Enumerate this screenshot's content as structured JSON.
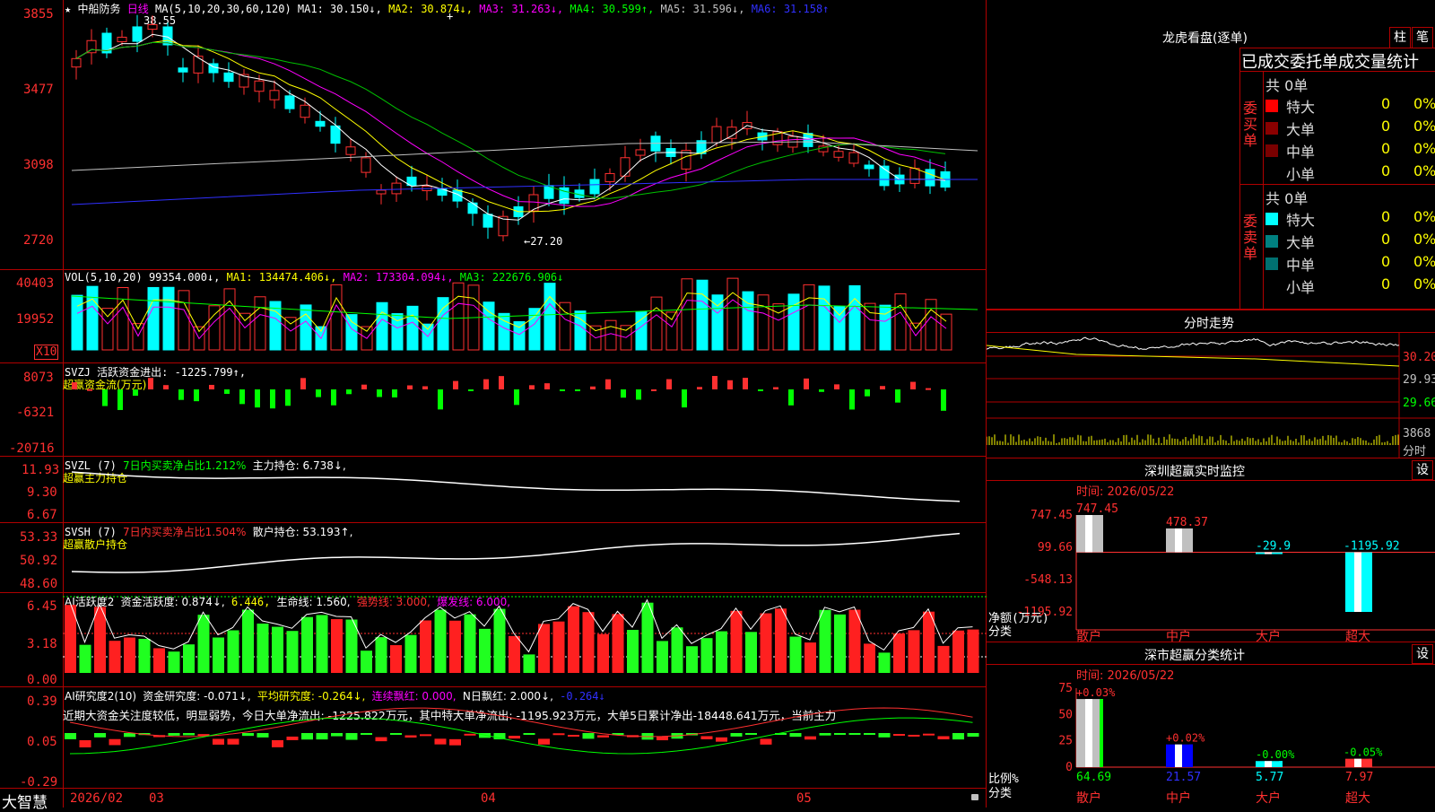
{
  "header": {
    "star": "★",
    "stock_name": "中船防务",
    "period": "日线",
    "ma_label": "MA(5,10,20,30,60,120)",
    "ma1": "MA1: 30.150↓,",
    "ma2": "MA2: 30.874↓,",
    "ma3": "MA3: 31.263↓,",
    "ma4": "MA4: 30.599↑,",
    "ma5": "MA5: 31.596↓,",
    "ma6": "MA6: 31.158↑"
  },
  "kline": {
    "y_ticks": [
      "3855",
      "3477",
      "3098",
      "2720"
    ],
    "high_label": "38.55",
    "low_label": "←27.20"
  },
  "vol": {
    "title": "VOL(5,10,20)",
    "value": "99354.000↓,",
    "ma1": "MA1: 134474.406↓,",
    "ma2": "MA2: 173304.094↓,",
    "ma3": "MA3: 222676.906↓",
    "y_ticks": [
      "40403",
      "19952"
    ],
    "unit": "X10"
  },
  "svzj": {
    "title": "SVZJ  活跃资金进出: -1225.799↑,",
    "sub": "超赢资金流(万元)",
    "y_ticks": [
      "8073",
      "-6321",
      "-20716"
    ]
  },
  "svzl": {
    "title": "SVZL (7)",
    "t2": "7日内买卖净占比1.212%",
    "t3": "主力持仓: 6.738↓,",
    "sub": "超赢主力持仓",
    "y_ticks": [
      "11.93",
      "9.30",
      "6.67"
    ]
  },
  "svsh": {
    "title": "SVSH (7)",
    "t2": "7日内买卖净占比1.504%",
    "t3": "散户持仓: 53.193↑,",
    "sub": "超赢散户持仓",
    "y_ticks": [
      "53.33",
      "50.92",
      "48.60"
    ]
  },
  "ai1": {
    "title": "AI活跃度2",
    "t2": "资金活跃度: 0.874↓,",
    "t3": "6.446,",
    "t4": "生命线: 1.560,",
    "t5": "强势线: 3.000,",
    "t6": "爆发线: 6.000,",
    "y_ticks": [
      "6.45",
      "3.18",
      "0.00"
    ]
  },
  "ai2": {
    "title": "AI研究度2(10)",
    "t2": "资金研究度: -0.071↓,",
    "t3": "平均研究度: -0.264↓,",
    "t4": "连续飘红: 0.000,",
    "t5": "N日飘红: 2.000↓,",
    "t6": "-0.264↓",
    "note": "近期大资金关注度较低，明显弱势，今日大单净流出: -1225.822万元，其中特大单净流出: -1195.923万元，大单5日累计净出-18448.641万元，当前主力",
    "y_ticks": [
      "0.39",
      "0.05",
      "-0.29"
    ]
  },
  "xaxis": {
    "brand": "大智慧",
    "labels": [
      "2026/02",
      "03",
      "04",
      "05"
    ]
  },
  "dragon": {
    "title": "龙虎看盘(逐单)",
    "btn1": "柱",
    "btn2": "笔",
    "subtitle": "已成交委托单成交量统计",
    "buy_label": "委买单",
    "sell_label": "委卖单",
    "buy_total": "共 0单",
    "sell_total": "共 0单",
    "buy_rows": [
      {
        "name": "特大",
        "count": "0",
        "pct": "0%",
        "color": "#ff0000"
      },
      {
        "name": "大单",
        "count": "0",
        "pct": "0%",
        "color": "#8b0000"
      },
      {
        "name": "中单",
        "count": "0",
        "pct": "0%",
        "color": "#7a0000"
      },
      {
        "name": "小单",
        "count": "0",
        "pct": "0%",
        "color": "#000000"
      }
    ],
    "sell_rows": [
      {
        "name": "特大",
        "count": "0",
        "pct": "0%",
        "color": "#00ffff"
      },
      {
        "name": "大单",
        "count": "0",
        "pct": "0%",
        "color": "#008080"
      },
      {
        "name": "中单",
        "count": "0",
        "pct": "0%",
        "color": "#007070"
      },
      {
        "name": "小单",
        "count": "0",
        "pct": "0%",
        "color": "#000000"
      }
    ]
  },
  "intraday": {
    "title": "分时走势",
    "y_ticks": [
      "30.20",
      "29.93",
      "29.66"
    ],
    "vol_tick": "3868",
    "unit": "分时"
  },
  "monitor": {
    "title": "深圳超赢实时监控",
    "btn": "设",
    "time": "时间: 2026/05/22",
    "y_ticks": [
      "747.45",
      "99.66",
      "-548.13",
      "-1195.92"
    ],
    "ylabel": "净额(万元)",
    "xlabel": "分类",
    "categories": [
      "散户",
      "中户",
      "大户",
      "超大"
    ],
    "chart_data": {
      "type": "bar",
      "categories": [
        "散户",
        "中户",
        "大户",
        "超大"
      ],
      "values": [
        747.45,
        478.37,
        -29.9,
        -1195.92
      ],
      "value_labels": [
        "747.45",
        "478.37",
        "-29.9",
        "-1195.92"
      ],
      "ylabel": "净额(万元)",
      "xlabel": "分类",
      "ylim": [
        -1195.92,
        747.45
      ]
    }
  },
  "classify": {
    "title": "深市超赢分类统计",
    "btn": "设",
    "time": "时间: 2026/05/22",
    "y_ticks": [
      "75",
      "50",
      "25",
      "0"
    ],
    "ylabel": "比例%",
    "xlabel": "分类",
    "categories": [
      "散户",
      "中户",
      "大户",
      "超大"
    ],
    "chart_data": {
      "type": "bar",
      "categories": [
        "散户",
        "中户",
        "大户",
        "超大"
      ],
      "values": [
        64.69,
        21.57,
        5.77,
        7.97
      ],
      "value_labels": [
        "64.69",
        "21.57",
        "5.77",
        "7.97"
      ],
      "change_labels": [
        "+0.03%",
        "+0.02%",
        "-0.00%",
        "-0.05%"
      ],
      "ylabel": "比例%",
      "xlabel": "分类",
      "ylim": [
        0,
        75
      ]
    }
  }
}
